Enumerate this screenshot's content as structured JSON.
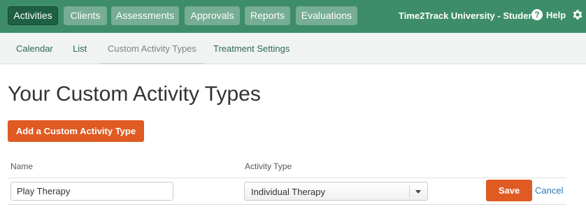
{
  "topnav": {
    "tabs": [
      {
        "label": "Activities",
        "active": true
      },
      {
        "label": "Clients",
        "active": false
      },
      {
        "label": "Assessments",
        "active": false
      },
      {
        "label": "Approvals",
        "active": false
      },
      {
        "label": "Reports",
        "active": false
      },
      {
        "label": "Evaluations",
        "active": false
      }
    ],
    "user_label": "Time2Track University - Student",
    "help_label": "Help",
    "help_icon": "question-circle-icon",
    "settings_icon": "gear-icon"
  },
  "subnav": {
    "items": [
      {
        "label": "Calendar",
        "active": false
      },
      {
        "label": "List",
        "active": false
      },
      {
        "label": "Custom Activity Types",
        "active": true
      },
      {
        "label": "Treatment Settings",
        "active": false
      }
    ]
  },
  "page": {
    "title": "Your Custom Activity Types",
    "add_button_label": "Add a Custom Activity Type"
  },
  "table": {
    "columns": [
      "Name",
      "Activity Type"
    ],
    "edit_row": {
      "name_value": "Play Therapy",
      "activity_type_selected": "Individual Therapy",
      "save_label": "Save",
      "cancel_label": "Cancel"
    }
  },
  "colors": {
    "header_green": "#3e8d6a",
    "active_tab": "#1f5f43",
    "accent_orange": "#e05a23",
    "link_blue": "#2a7ab8"
  }
}
